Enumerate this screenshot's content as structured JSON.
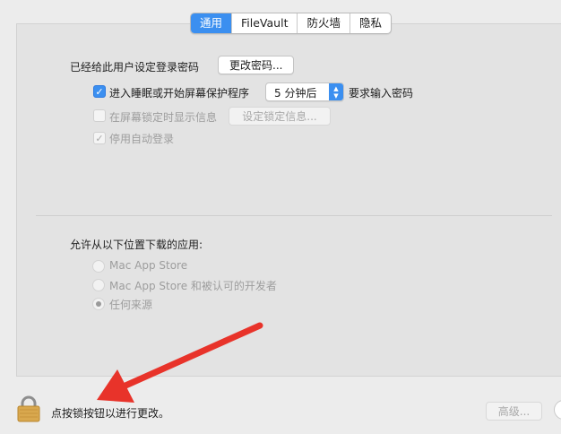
{
  "tabs": [
    {
      "label": "通用",
      "active": true
    },
    {
      "label": "FileVault",
      "active": false
    },
    {
      "label": "防火墙",
      "active": false
    },
    {
      "label": "隐私",
      "active": false
    }
  ],
  "general": {
    "password_label": "已经给此用户设定登录密码",
    "change_password_button": "更改密码...",
    "require_password": {
      "checked": true,
      "label": "进入睡眠或开始屏幕保护程序",
      "delay_value": "5 分钟后",
      "suffix": "要求输入密码"
    },
    "show_message": {
      "checked": false,
      "label": "在屏幕锁定时显示信息",
      "button": "设定锁定信息..."
    },
    "disable_auto_login": {
      "checked": true,
      "label": "停用自动登录"
    }
  },
  "downloads": {
    "title": "允许从以下位置下载的应用:",
    "options": [
      {
        "label": "Mac App Store",
        "selected": false
      },
      {
        "label": "Mac App Store 和被认可的开发者",
        "selected": false
      },
      {
        "label": "任何来源",
        "selected": true
      }
    ]
  },
  "footer": {
    "lock_hint": "点按锁按钮以进行更改。",
    "advanced_button": "高级..."
  },
  "colors": {
    "accent": "#3b8ff0",
    "annotation_arrow": "#e8332a"
  },
  "icons": {
    "lock": "lock-icon",
    "checkmark": "checkmark-icon",
    "popup_arrows": "chevron-updown-icon",
    "help": "help-icon"
  }
}
